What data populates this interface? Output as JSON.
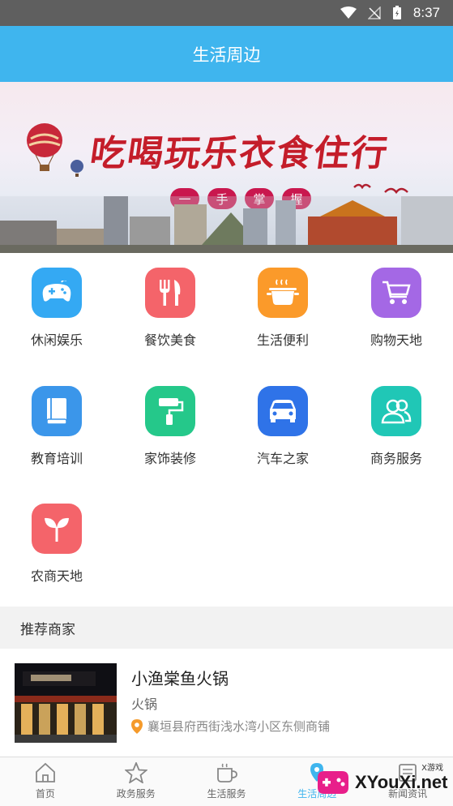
{
  "status_bar": {
    "time": "8:37"
  },
  "header": {
    "title": "生活周边"
  },
  "banner": {
    "slogan": "吃喝玩乐衣食住行",
    "pills": [
      "一",
      "手",
      "掌",
      "握"
    ]
  },
  "categories": [
    {
      "label": "休闲娱乐",
      "color": "#34a9f3",
      "icon": "gamepad-icon"
    },
    {
      "label": "餐饮美食",
      "color": "#f4646a",
      "icon": "fork-knife-icon"
    },
    {
      "label": "生活便利",
      "color": "#fb9a2a",
      "icon": "pot-icon"
    },
    {
      "label": "购物天地",
      "color": "#a468e5",
      "icon": "cart-icon"
    },
    {
      "label": "教育培训",
      "color": "#3b96ea",
      "icon": "book-icon"
    },
    {
      "label": "家饰装修",
      "color": "#25c88a",
      "icon": "paint-roller-icon"
    },
    {
      "label": "汽车之家",
      "color": "#2f73e8",
      "icon": "car-icon"
    },
    {
      "label": "商务服务",
      "color": "#20c7b6",
      "icon": "people-icon"
    },
    {
      "label": "农商天地",
      "color": "#f4646a",
      "icon": "sprout-icon"
    }
  ],
  "recommend": {
    "section_title": "推荐商家",
    "merchant": {
      "name": "小渔棠鱼火锅",
      "category": "火锅",
      "address": "襄垣县府西街浅水湾小区东侧商铺"
    }
  },
  "tabs": [
    {
      "label": "首页",
      "icon": "home-icon"
    },
    {
      "label": "政务服务",
      "icon": "star-icon"
    },
    {
      "label": "生活服务",
      "icon": "cup-icon"
    },
    {
      "label": "生活周边",
      "icon": "location-icon",
      "active": true
    },
    {
      "label": "新闻资讯",
      "icon": "news-icon"
    }
  ],
  "watermark": {
    "text": "XYouXi.net",
    "small": "X游戏"
  }
}
